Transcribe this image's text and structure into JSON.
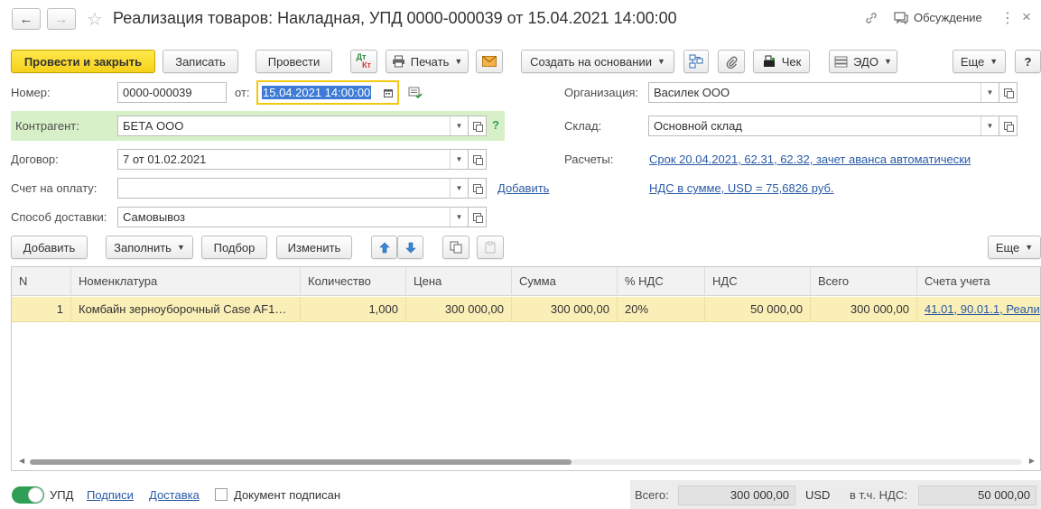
{
  "window": {
    "title": "Реализация товаров: Накладная, УПД 0000-000039 от 15.04.2021 14:00:00",
    "discussion": "Обсуждение"
  },
  "toolbar": {
    "post_and_close": "Провести и закрыть",
    "save": "Записать",
    "post": "Провести",
    "dt_kt_top": "Дт",
    "dt_kt_bottom": "Кт",
    "print": "Печать",
    "create_based_on": "Создать на основании",
    "receipt": "Чек",
    "edo": "ЭДО",
    "more": "Еще",
    "help": "?"
  },
  "form": {
    "number_label": "Номер:",
    "number_value": "0000-000039",
    "date_label": "от:",
    "date_value": "15.04.2021 14:00:00",
    "counterparty_label": "Контрагент:",
    "counterparty_value": "БЕТА ООО",
    "counterparty_help": "?",
    "contract_label": "Договор:",
    "contract_value": "7 от 01.02.2021",
    "invoice_label": "Счет на оплату:",
    "invoice_value": "",
    "invoice_add": "Добавить",
    "delivery_label": "Способ доставки:",
    "delivery_value": "Самовывоз",
    "org_label": "Организация:",
    "org_value": "Василек ООО",
    "warehouse_label": "Склад:",
    "warehouse_value": "Основной склад",
    "settlements_label": "Расчеты:",
    "settlements_link": "Срок 20.04.2021, 62.31, 62.32, зачет аванса автоматически",
    "vat_link": "НДС в сумме, USD = 75,6826 руб."
  },
  "table_toolbar": {
    "add": "Добавить",
    "fill": "Заполнить",
    "select": "Подбор",
    "change": "Изменить",
    "more": "Еще"
  },
  "table": {
    "columns": [
      "N",
      "Номенклатура",
      "Количество",
      "Цена",
      "Сумма",
      "% НДС",
      "НДС",
      "Всего",
      "Счета учета"
    ],
    "rows": [
      [
        "1",
        "Комбайн зерноуборочный Case AF1…",
        "1,000",
        "300 000,00",
        "300 000,00",
        "20%",
        "50 000,00",
        "300 000,00",
        "41.01, 90.01.1, Реали"
      ]
    ]
  },
  "footer": {
    "upd_label": "УПД",
    "signatures_link": "Подписи",
    "delivery_link": "Доставка",
    "signed_label": "Документ подписан",
    "total_label": "Всего:",
    "total_value": "300 000,00",
    "currency": "USD",
    "vat_label": "в т.ч. НДС:",
    "vat_value": "50 000,00"
  },
  "colors": {
    "primary_button": "#f6d11b",
    "selected_row": "#fbefb8",
    "highlight_field_bg": "#d7f0c8",
    "link": "#2a5aa5",
    "toggle_on": "#2e9f55"
  }
}
